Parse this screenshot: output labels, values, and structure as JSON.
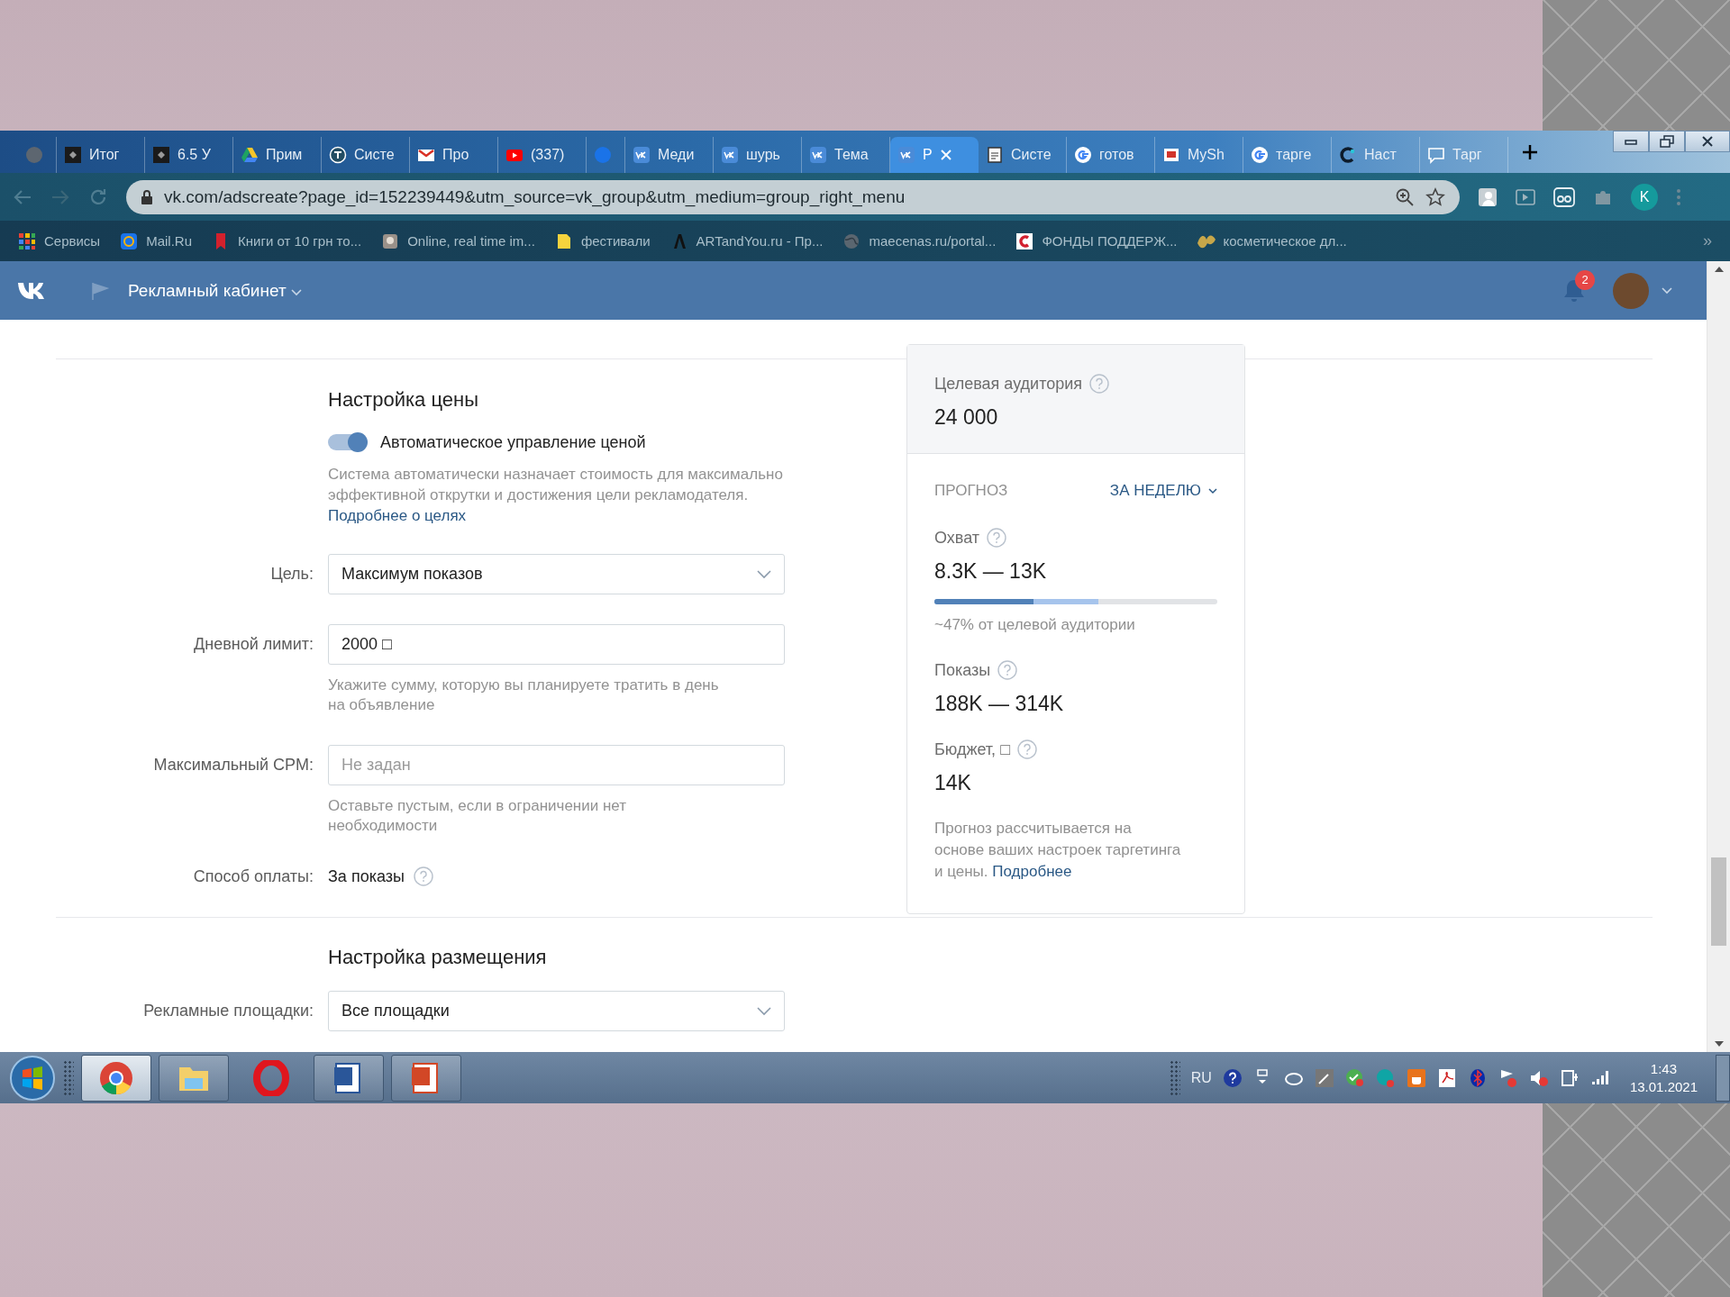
{
  "browser": {
    "tabs": [
      {
        "kind": "grey",
        "selected": false
      },
      {
        "kind": "dark",
        "title": "Итог",
        "selected": false
      },
      {
        "kind": "dark",
        "title": "6.5 У",
        "selected": false
      },
      {
        "kind": "drive",
        "title": "Прим",
        "selected": false
      },
      {
        "kind": "ring",
        "title": "Систе",
        "selected": false
      },
      {
        "kind": "mail",
        "title": "Про",
        "selected": false
      },
      {
        "kind": "video",
        "title": "(337)",
        "selected": false
      },
      {
        "kind": "dot",
        "selected": false
      },
      {
        "kind": "vk",
        "title": "Меди",
        "selected": false
      },
      {
        "kind": "vk",
        "title": "шурь",
        "selected": false
      },
      {
        "kind": "vk",
        "title": "Тема",
        "selected": false
      },
      {
        "kind": "vk",
        "title": "Р",
        "selected": true
      },
      {
        "kind": "doc",
        "title": "Систе",
        "selected": false
      },
      {
        "kind": "g",
        "title": "готов",
        "selected": false
      },
      {
        "kind": "red",
        "title": "MySh",
        "selected": false
      },
      {
        "kind": "g",
        "title": "тарге",
        "selected": false
      },
      {
        "kind": "c",
        "title": "Наст",
        "selected": false
      },
      {
        "kind": "chat",
        "title": "Тарг",
        "selected": false
      }
    ],
    "address": {
      "url": "vk.com/adscreate?page_id=152239449&utm_source=vk_group&utm_medium=group_right_menu"
    },
    "profile": "K",
    "bookmarks": [
      {
        "kind": "apps",
        "label": "Сервисы"
      },
      {
        "kind": "at",
        "label": "Mail.Ru"
      },
      {
        "kind": "book",
        "label": "Книги от 10 грн то..."
      },
      {
        "kind": "photo",
        "label": "Online, real time im..."
      },
      {
        "kind": "folder",
        "label": "фестивали"
      },
      {
        "kind": "black",
        "label": "ARTandYou.ru - Пр..."
      },
      {
        "kind": "globe",
        "label": "maecenas.ru/portal..."
      },
      {
        "kind": "cred",
        "label": "ФОНДЫ ПОДДЕРЖ..."
      },
      {
        "kind": "leaf",
        "label": "косметическое дл..."
      }
    ],
    "bookmarks_more": "»"
  },
  "header": {
    "title": "Рекламный кабинет",
    "notification_count": "2"
  },
  "price_settings": {
    "heading": "Настройка цены",
    "auto_price": {
      "label": "Автоматическое управление ценой",
      "on": true
    },
    "description": "Система автоматически назначает стоимость для максимально эффективной открутки и достижения цели рекламодателя.",
    "description_link": "Подробнее о целях",
    "rows": [
      {
        "kind": "select",
        "label": "Цель:",
        "value": "Максимум показов"
      },
      {
        "kind": "input",
        "label": "Дневной лимит:",
        "value": "2000 □"
      },
      {
        "kind": "hint",
        "text": "Укажите сумму, которую вы планируете тратить в день на объявление"
      },
      {
        "kind": "input",
        "label": "Максимальный CPM:",
        "placeholder": "Не задан"
      },
      {
        "kind": "hint",
        "text": "Оставьте пустым, если в ограничении нет необходимости"
      },
      {
        "kind": "text",
        "label": "Способ оплаты:",
        "value": "За показы"
      }
    ]
  },
  "forecast_card": {
    "audience_label": "Целевая аудитория",
    "audience_value": "24 000",
    "forecast_label": "ПРОГНОЗ",
    "period": "ЗА НЕДЕЛЮ",
    "reach": {
      "label": "Охват",
      "value": "8.3K — 13K",
      "bar_low": {
        "level": 0.35
      },
      "bar_high": {
        "level": 0.58
      },
      "note": "~47% от целевой аудитории"
    },
    "impressions": {
      "label": "Показы",
      "value": "188K — 314K"
    },
    "budget": {
      "label": "Бюджет, □",
      "value": "14K"
    },
    "footnote": "Прогноз рассчитывается на основе ваших настроек таргетинга и цены.",
    "footnote_link": "Подробнее"
  },
  "placement_settings": {
    "heading": "Настройка размещения",
    "rows": [
      {
        "kind": "select",
        "label": "Рекламные площадки:",
        "value": "Все площадки"
      }
    ]
  },
  "taskbar": {
    "apps": [
      {
        "kind": "chrome",
        "selected": true
      },
      {
        "kind": "folder",
        "selected": false
      },
      {
        "kind": "opera",
        "selected": false
      },
      {
        "kind": "word",
        "selected": false
      },
      {
        "kind": "ppt",
        "selected": false
      }
    ],
    "language": "RU",
    "time": "1:43",
    "date": "13.01.2021"
  }
}
